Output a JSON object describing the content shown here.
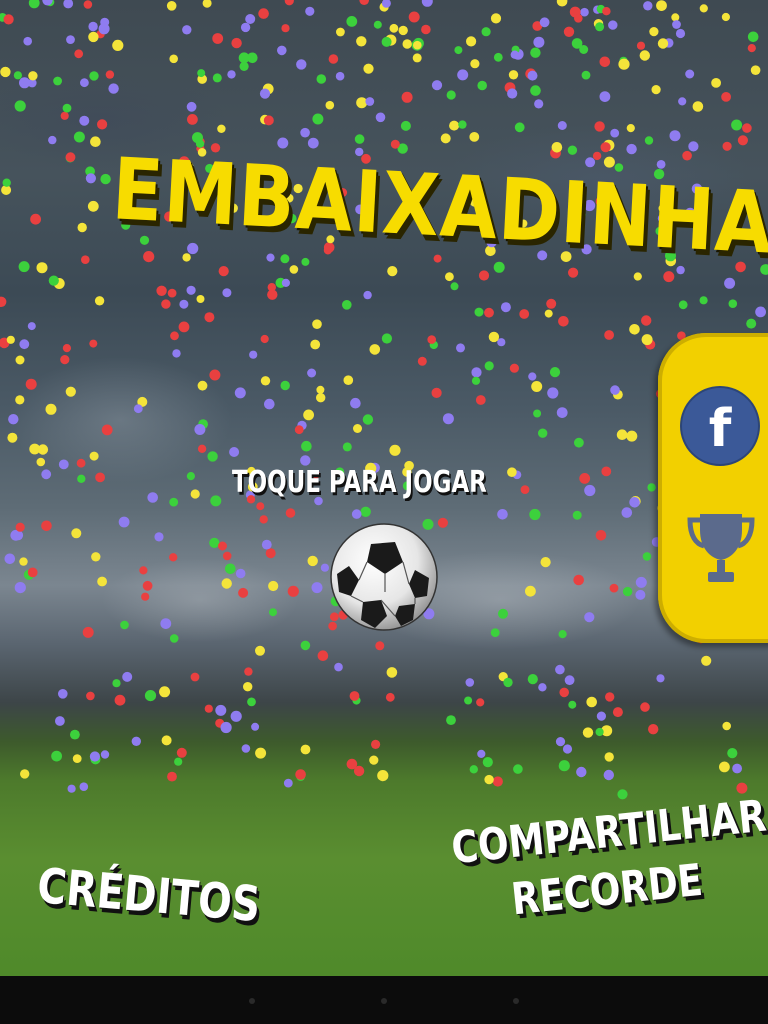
{
  "game": {
    "title": "EMBAIXADINHA",
    "tap_prompt": "TOQUE PARA JOGAR",
    "credits_label": "CRÉDITOS",
    "share_label_line1": "COMPARTILHAR",
    "share_label_line2": "RECORDE"
  },
  "side_panel": {
    "facebook_glyph": "f",
    "icons": [
      "facebook-icon",
      "trophy-icon"
    ]
  },
  "colors": {
    "title": "#f7dc00",
    "panel": "#f2d000",
    "facebook": "#3b5998",
    "trophy": "#5b6a8c",
    "confetti": [
      "#e94040",
      "#f4e43a",
      "#3cd13c",
      "#8f7cf0"
    ]
  },
  "navbar": {
    "buttons": [
      "back-icon",
      "home-icon",
      "recents-icon"
    ]
  }
}
